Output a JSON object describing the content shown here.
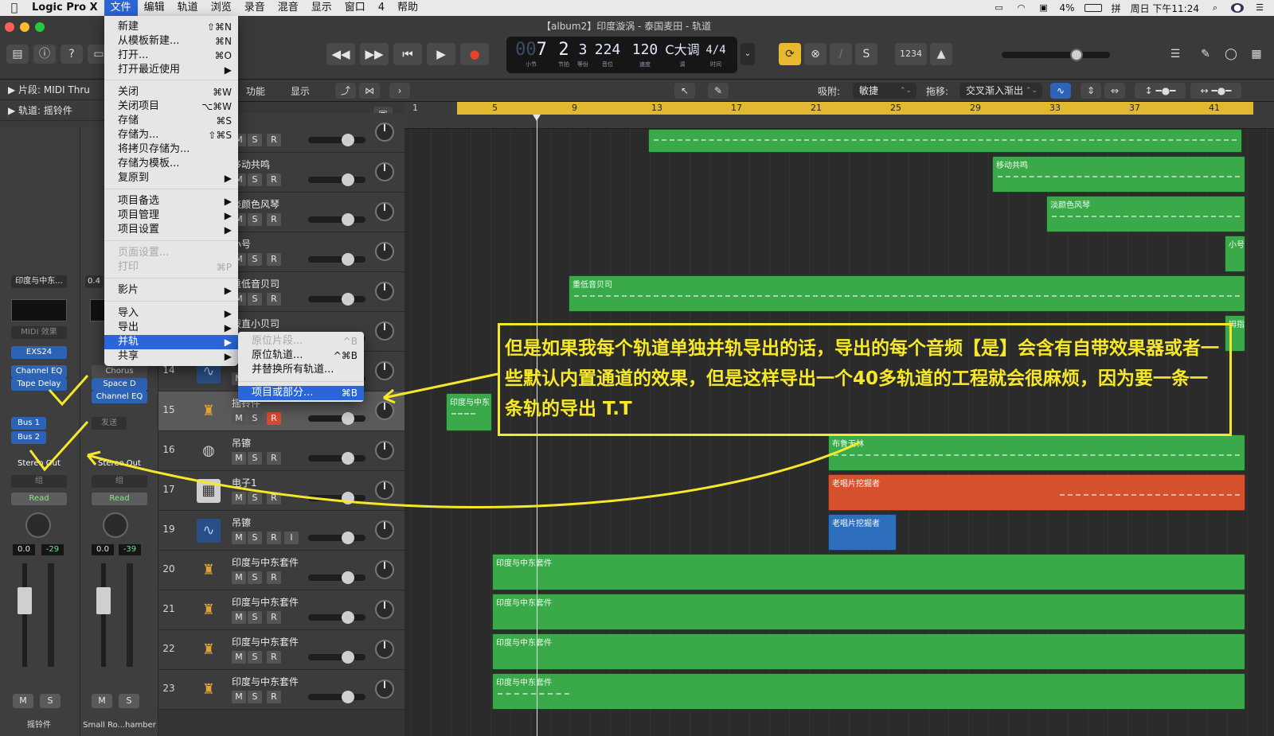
{
  "menubar": {
    "app_name": "Logic Pro X",
    "items": [
      "文件",
      "编辑",
      "轨道",
      "浏览",
      "录音",
      "混音",
      "显示",
      "窗口",
      "4",
      "帮助"
    ],
    "battery": "4%",
    "input_method": "拼",
    "clock": "周日 下午11:24"
  },
  "window": {
    "title": "【album2】印度漩涡 - 泰国麦田 - 轨道"
  },
  "lcd": {
    "bar": "7",
    "bar_lead": "00",
    "beat": "2",
    "div": "3",
    "tick": "224",
    "tempo": "120",
    "key": "C大调",
    "signature": "4/4",
    "label_bar": "小节",
    "label_beat": "节拍",
    "label_div": "等份",
    "label_tick": "音位",
    "label_tempo": "速度",
    "label_key": "调",
    "label_sig": "时间"
  },
  "controlbar": {
    "counter_label": "1234"
  },
  "inspector": {
    "region_label": "▶ 片段:  MIDI Thru",
    "track_label": "▶ 轨道:  摇铃件"
  },
  "strip1": {
    "setting": "印度与中东...",
    "midi_fx": "MIDI 效果",
    "instrument": "EXS24",
    "plugins": [
      "Channel EQ",
      "Tape Delay"
    ],
    "sends": [
      "Bus 1",
      "Bus 2"
    ],
    "output": "Stereo Out",
    "group": "组",
    "automation": "Read",
    "vol": "0.0",
    "peak": "-29",
    "mute": "M",
    "solo": "S",
    "name": "摇铃件"
  },
  "strip2": {
    "setting": "0.4",
    "plugins": [
      "Chorus",
      "Space D",
      "Channel EQ"
    ],
    "send_label": "发送",
    "output": "Stereo Out",
    "group": "组",
    "automation": "Read",
    "vol": "0.0",
    "peak": "-39",
    "mute": "M",
    "solo": "S",
    "name": "Small Ro...hamber"
  },
  "localbar": {
    "functions": "功能",
    "view": "显示",
    "snap_label": "吸附:",
    "snap_value": "敏捷",
    "drag_label": "拖移:",
    "drag_value": "交叉渐入渐出"
  },
  "tracks": [
    {
      "num": "",
      "name": "",
      "icon": ""
    },
    {
      "num": "",
      "name": "移动共鸣",
      "icon": ""
    },
    {
      "num": "",
      "name": "淡颜色风琴",
      "icon": ""
    },
    {
      "num": "",
      "name": "小号",
      "icon": ""
    },
    {
      "num": "",
      "name": "重低音贝司",
      "icon": ""
    },
    {
      "num": "",
      "name": "拨直小贝司",
      "icon": ""
    },
    {
      "num": "14",
      "name": "",
      "icon": "waveform-icon"
    },
    {
      "num": "15",
      "name": "摇铃件",
      "icon": "percussion-icon"
    },
    {
      "num": "16",
      "name": "吊镲",
      "icon": "drum-icon"
    },
    {
      "num": "17",
      "name": "电子1",
      "icon": "synth-icon"
    },
    {
      "num": "19",
      "name": "吊镲",
      "icon": "waveform-icon"
    },
    {
      "num": "20",
      "name": "印度与中东套件",
      "icon": "percussion-icon"
    },
    {
      "num": "21",
      "name": "印度与中东套件",
      "icon": "percussion-icon"
    },
    {
      "num": "22",
      "name": "印度与中东套件",
      "icon": "percussion-icon"
    },
    {
      "num": "23",
      "name": "印度与中东套件",
      "icon": "percussion-icon"
    }
  ],
  "track_buttons": {
    "m": "M",
    "s": "S",
    "r": "R",
    "i": "I"
  },
  "ruler": [
    "1",
    "5",
    "9",
    "13",
    "17",
    "21",
    "25",
    "29",
    "33",
    "37",
    "41"
  ],
  "regions": {
    "r1": "移动共鸣",
    "r2": "淡颜色风琴",
    "r3": "小号",
    "r4": "重低音贝司",
    "r5": "拇指",
    "r6": "印度与中东",
    "r7": "布鲁无林",
    "r8": "老唱片挖掘者",
    "r9": "老唱片挖掘者",
    "r10": "印度与中东套件",
    "r11": "印度与中东套件",
    "r12": "印度与中东套件",
    "r13": "印度与中东套件"
  },
  "file_menu": [
    {
      "label": "新建",
      "shortcut": "⇧⌘N"
    },
    {
      "label": "从模板新建...",
      "shortcut": "⌘N"
    },
    {
      "label": "打开...",
      "shortcut": "⌘O"
    },
    {
      "label": "打开最近使用",
      "shortcut": "▶"
    },
    {
      "label": "关闭",
      "shortcut": "⌘W"
    },
    {
      "label": "关闭项目",
      "shortcut": "⌥⌘W"
    },
    {
      "label": "存储",
      "shortcut": "⌘S"
    },
    {
      "label": "存储为...",
      "shortcut": "⇧⌘S"
    },
    {
      "label": "将拷贝存储为...",
      "shortcut": ""
    },
    {
      "label": "存储为模板...",
      "shortcut": ""
    },
    {
      "label": "复原到",
      "shortcut": "▶"
    },
    {
      "label": "项目备选",
      "shortcut": "▶"
    },
    {
      "label": "项目管理",
      "shortcut": "▶"
    },
    {
      "label": "项目设置",
      "shortcut": "▶"
    },
    {
      "label": "页面设置...",
      "shortcut": ""
    },
    {
      "label": "打印",
      "shortcut": "⌘P"
    },
    {
      "label": "影片",
      "shortcut": "▶"
    },
    {
      "label": "导入",
      "shortcut": "▶"
    },
    {
      "label": "导出",
      "shortcut": "▶"
    },
    {
      "label": "并轨",
      "shortcut": "▶"
    },
    {
      "label": "共享",
      "shortcut": "▶"
    }
  ],
  "bounce_submenu": [
    {
      "label": "原位片段...",
      "shortcut": "^B"
    },
    {
      "label": "原位轨道...",
      "shortcut": "^⌘B"
    },
    {
      "label": "并替换所有轨道...",
      "shortcut": ""
    },
    {
      "label": "项目或部分...",
      "shortcut": "⌘B"
    }
  ],
  "annotation": {
    "text": "但是如果我每个轨道单独并轨导出的话，导出的每个音频【是】会含有自带效果器或者一些默认内置通道的效果，但是这样导出一个40多轨道的工程就会很麻烦，因为要一条一条轨的导出 T.T"
  },
  "colors": {
    "region_green": "#3aa94a",
    "region_orange": "#d8512e",
    "region_blue": "#2d6fbd",
    "annotation_yellow": "#f5e72a",
    "menu_highlight": "#2a66d8",
    "cycle_yellow": "#e1b82f"
  }
}
